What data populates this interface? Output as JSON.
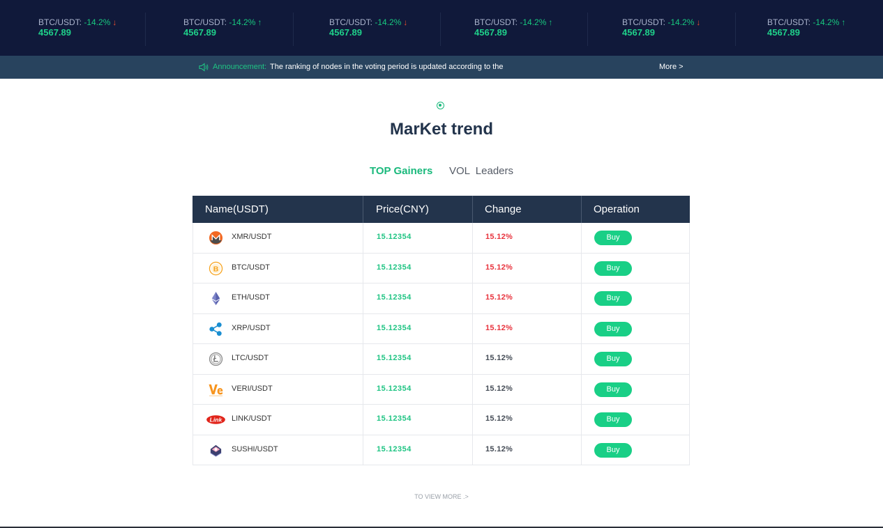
{
  "ticker": [
    {
      "pair": "BTC/USDT:",
      "change": "-14.2%",
      "arrow": "↓",
      "direction": "down",
      "price": "4567.89"
    },
    {
      "pair": "BTC/USDT:",
      "change": "-14.2%",
      "arrow": "↑",
      "direction": "up",
      "price": "4567.89"
    },
    {
      "pair": "BTC/USDT:",
      "change": "-14.2%",
      "arrow": "↓",
      "direction": "down",
      "price": "4567.89"
    },
    {
      "pair": "BTC/USDT:",
      "change": "-14.2%",
      "arrow": "↑",
      "direction": "up",
      "price": "4567.89"
    },
    {
      "pair": "BTC/USDT:",
      "change": "-14.2%",
      "arrow": "↓",
      "direction": "down",
      "price": "4567.89"
    },
    {
      "pair": "BTC/USDT:",
      "change": "-14.2%",
      "arrow": "↑",
      "direction": "up",
      "price": "4567.89"
    }
  ],
  "announcement": {
    "icon": "speaker-icon",
    "label": "Announcement:",
    "text": "The ranking of nodes in the voting period is updated according to the",
    "more": "More >"
  },
  "section": {
    "title": "MarKet trend",
    "tabs": [
      "TOP Gainers",
      "VOL  Leaders"
    ],
    "active_tab": "TOP Gainers"
  },
  "table": {
    "headers": [
      "Name(USDT)",
      "Price(CNY)",
      "Change",
      "Operation"
    ],
    "rows": [
      {
        "icon": "monero-icon",
        "name": "XMR/USDT",
        "price": "15.12354",
        "change": "15.12%",
        "change_color": "red",
        "action": "Buy"
      },
      {
        "icon": "bitcoin-icon",
        "name": "BTC/USDT",
        "price": "15.12354",
        "change": "15.12%",
        "change_color": "red",
        "action": "Buy"
      },
      {
        "icon": "ethereum-icon",
        "name": "ETH/USDT",
        "price": "15.12354",
        "change": "15.12%",
        "change_color": "red",
        "action": "Buy"
      },
      {
        "icon": "ripple-icon",
        "name": "XRP/USDT",
        "price": "15.12354",
        "change": "15.12%",
        "change_color": "red",
        "action": "Buy"
      },
      {
        "icon": "litecoin-icon",
        "name": "LTC/USDT",
        "price": "15.12354",
        "change": "15.12%",
        "change_color": "gray",
        "action": "Buy"
      },
      {
        "icon": "veritaseum-icon",
        "name": "VERI/USDT",
        "price": "15.12354",
        "change": "15.12%",
        "change_color": "gray",
        "action": "Buy"
      },
      {
        "icon": "chainlink-icon",
        "name": "LINK/USDT",
        "price": "15.12354",
        "change": "15.12%",
        "change_color": "gray",
        "action": "Buy"
      },
      {
        "icon": "sushi-icon",
        "name": "SUSHI/USDT",
        "price": "15.12354",
        "change": "15.12%",
        "change_color": "gray",
        "action": "Buy"
      }
    ]
  },
  "view_more": "TO VIEW MORE .>",
  "colors": {
    "ticker_bg": "#10193a",
    "announce_bg": "#28435e",
    "accent_green": "#19cf86",
    "header_bg": "#23344c",
    "change_red": "#e8323c"
  }
}
